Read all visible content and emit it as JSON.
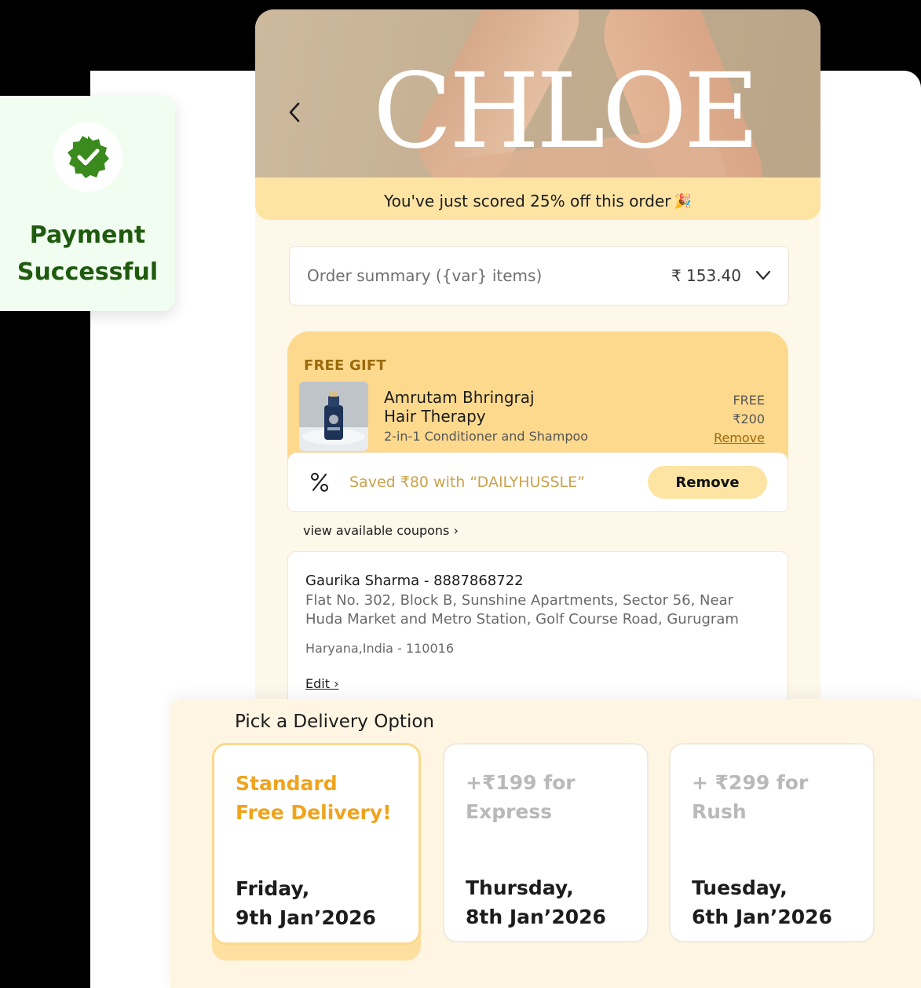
{
  "payment": {
    "title_line1": "Payment",
    "title_line2": "Successful",
    "badge_color": "#3b8a1d"
  },
  "header": {
    "brand": "CHLOE",
    "back_icon": "chevron-left-icon"
  },
  "offer": {
    "text": "You've just scored 25% off this order",
    "emoji": "🎉"
  },
  "summary": {
    "label": "Order summary ({var} items)",
    "amount": "₹ 153.40"
  },
  "gift": {
    "label": "FREE GIFT",
    "name_line1": "Amrutam Bhringraj",
    "name_line2": "Hair Therapy",
    "subtitle": "2-in-1 Conditioner and Shampoo",
    "price_free": "FREE",
    "price_original": "₹200",
    "remove_label": "Remove"
  },
  "coupon": {
    "icon": "percent-icon",
    "text": "Saved ₹80 with “DAILYHUSSLE”",
    "remove_label": "Remove"
  },
  "view_coupons": "view available coupons ›",
  "address": {
    "name": "Gaurika Sharma - 8887868722",
    "lines": "Flat No. 302, Block B, Sunshine Apartments, Sector 56, Near Huda Market and Metro Station, Golf Course Road, Gurugram",
    "state": "Haryana,India - 110016",
    "edit_label": "Edit ›"
  },
  "delivery": {
    "title": "Pick a Delivery Option",
    "options": [
      {
        "head_line1": "Standard",
        "head_line2": "Free Delivery!",
        "day": "Friday,",
        "date": "9th Jan’2026",
        "selected": true
      },
      {
        "head_line1": "+₹199 for",
        "head_line2": "Express",
        "day": "Thursday,",
        "date": "8th Jan’2026",
        "selected": false
      },
      {
        "head_line1": "+ ₹299 for",
        "head_line2": "Rush",
        "day": "Tuesday,",
        "date": "6th Jan’2026",
        "selected": false
      }
    ]
  },
  "colors": {
    "accent_yellow": "#fde4a3",
    "gift_yellow": "#fdd98e",
    "selected_orange": "#f0a31c",
    "success_green": "#1f5a0f"
  }
}
